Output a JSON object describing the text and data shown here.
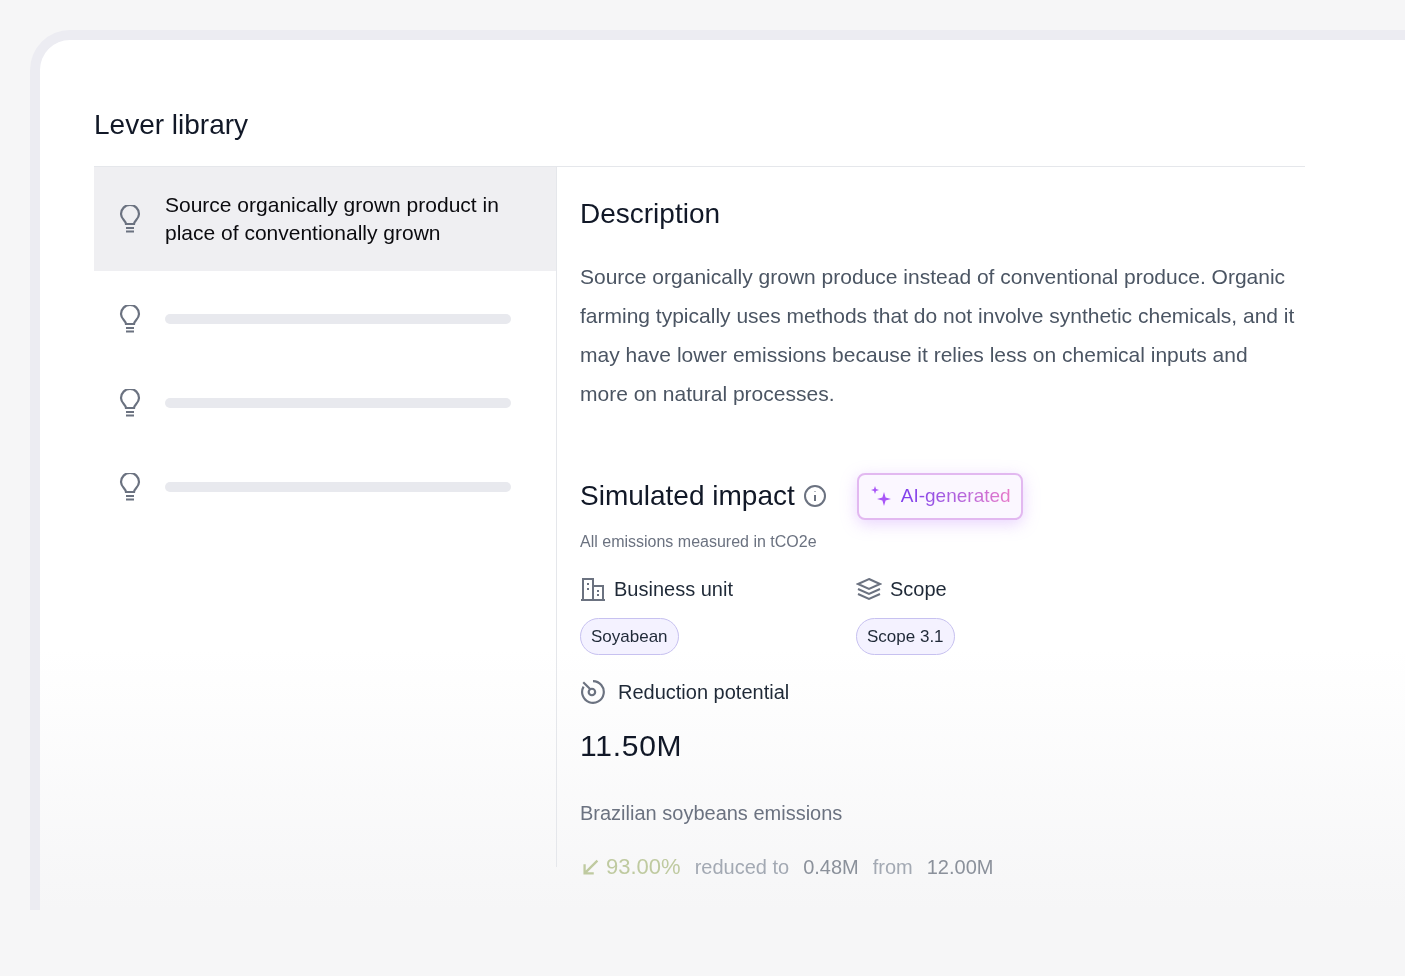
{
  "title": "Lever library",
  "levers": [
    {
      "kind": "text",
      "label": "Source organically grown product in place of conventionally grown",
      "selected": true
    },
    {
      "kind": "skeleton",
      "selected": false
    },
    {
      "kind": "skeleton",
      "selected": false
    },
    {
      "kind": "skeleton",
      "selected": false
    }
  ],
  "description": {
    "heading": "Description",
    "text": "Source organically grown produce instead of conventional produce. Organic farming typically uses methods that do not involve synthetic chemicals, and it may have lower emissions because it relies less on chemical inputs and more on natural processes."
  },
  "impact": {
    "heading": "Simulated impact",
    "badge": "AI-generated",
    "note": "All emissions measured in tCO2e",
    "fields": [
      {
        "kind": "building",
        "label": "Business unit",
        "tag": "Soyabean"
      },
      {
        "kind": "layers",
        "label": "Scope",
        "tag": "Scope 3.1"
      }
    ],
    "reduction": {
      "label": "Reduction potential",
      "value": "11.50M",
      "source": "Brazilian soybeans emissions",
      "percent": "93.00%",
      "reduced_label": "reduced to",
      "to_value": "0.48M",
      "from_label": "from",
      "from_value": "12.00M"
    }
  }
}
